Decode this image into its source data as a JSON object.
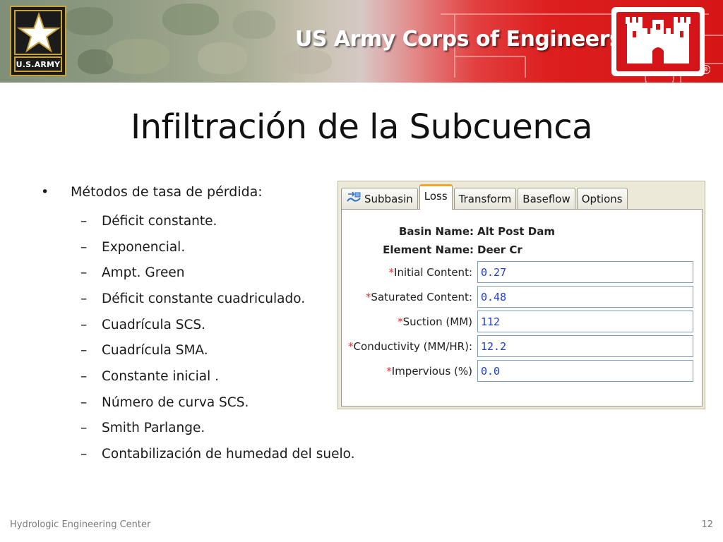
{
  "header": {
    "army_logo_text": "U.S.ARMY",
    "corps_title": "US Army Corps of Engineers",
    "registered_mark": "®",
    "colors": {
      "camo_green": "#8c9a80",
      "army_red": "#d61616",
      "gold": "#c9a23a"
    }
  },
  "slide": {
    "title": "Infiltración de la Subcuenca",
    "bullet_symbol": "•",
    "dash_symbol": "–",
    "main_bullet": "Métodos de tasa de pérdida:",
    "sub_items": [
      "Déficit constante.",
      "Exponencial.",
      "Ampt. Green",
      "Déficit constante cuadriculado.",
      "Cuadrícula SCS.",
      "Cuadrícula SMA.",
      "Constante inicial .",
      "Número de curva SCS.",
      "Smith Parlange.",
      "Contabilización de humedad del suelo."
    ]
  },
  "panel": {
    "tabs": [
      {
        "label": "Subbasin",
        "icon": "subbasin-icon"
      },
      {
        "label": "Loss",
        "active": true
      },
      {
        "label": "Transform"
      },
      {
        "label": "Baseflow"
      },
      {
        "label": "Options"
      }
    ],
    "basin_label": "Basin Name:",
    "basin_value": "Alt Post Dam",
    "element_label": "Element Name:",
    "element_value": "Deer Cr",
    "required_marker": "*",
    "fields": [
      {
        "label": "Initial Content:",
        "value": "0.27"
      },
      {
        "label": "Saturated Content:",
        "value": "0.48"
      },
      {
        "label": "Suction (MM)",
        "value": "112"
      },
      {
        "label": "Conductivity (MM/HR):",
        "value": "12.2"
      },
      {
        "label": "Impervious (%)",
        "value": "0.0"
      }
    ]
  },
  "footer": {
    "organization": "Hydrologic Engineering Center",
    "page_number": "12"
  }
}
